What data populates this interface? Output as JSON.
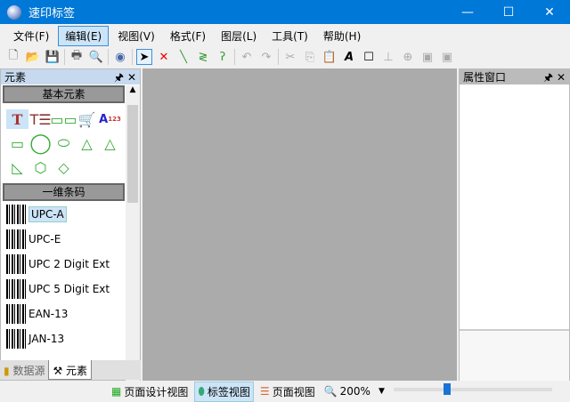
{
  "window": {
    "title": "速印标签",
    "minimize": "—",
    "maximize": "☐",
    "close": "✕"
  },
  "menu": [
    "文件(F)",
    "编辑(E)",
    "视图(V)",
    "格式(F)",
    "图层(L)",
    "工具(T)",
    "帮助(H)"
  ],
  "left_panel": {
    "title": "元素",
    "pin": "🖈",
    "close": "✕",
    "group_basic": "基本元素",
    "group_barcode": "一维条码",
    "barcodes": [
      "UPC-A",
      "UPC-E",
      "UPC 2 Digit Ext",
      "UPC 5 Digit Ext",
      "EAN-13",
      "JAN-13"
    ],
    "tabs": [
      "数据源",
      "元素"
    ]
  },
  "right_panel": {
    "title": "属性窗口",
    "pin": "🖈",
    "close": "✕"
  },
  "status": {
    "design_view": "页面设计视图",
    "label_view": "标签视图",
    "page_view": "页面视图",
    "zoom": "200%",
    "zoom_slider_fraction": 0.33
  }
}
